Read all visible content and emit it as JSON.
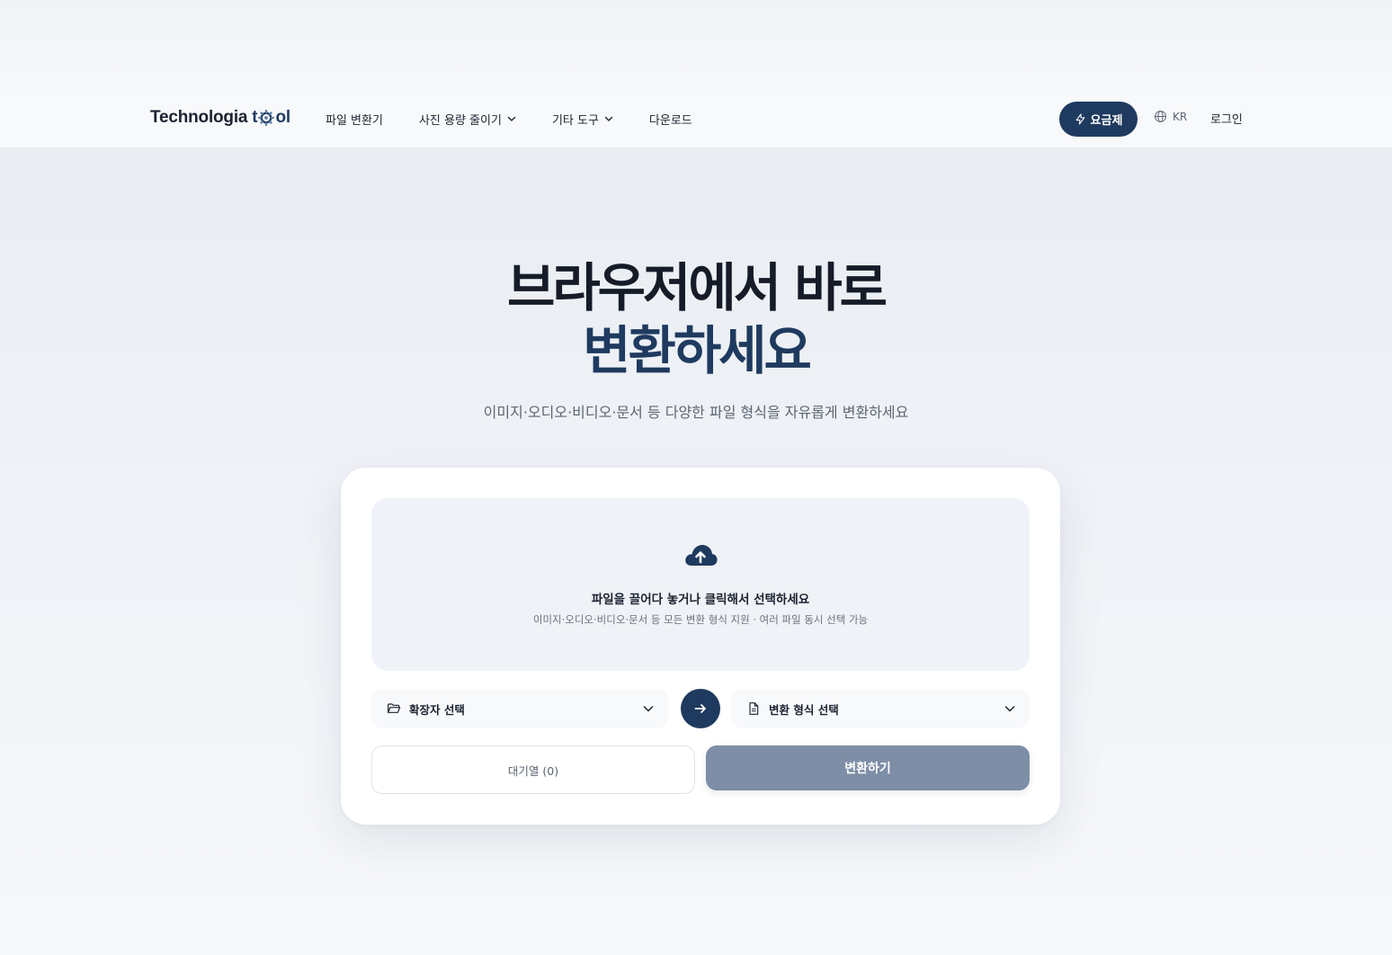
{
  "header": {
    "logo": {
      "text_part1": "Technologia",
      "text_part2_a": "t",
      "text_part2_b": "ol"
    },
    "nav": [
      {
        "label": "파일 변환기"
      },
      {
        "label": "사진 용량 줄이기"
      },
      {
        "label": "기타 도구"
      },
      {
        "label": "다운로드"
      }
    ],
    "pricing_label": "요금제",
    "lang_label": "KR",
    "login_label": "로그인"
  },
  "hero": {
    "title_line1": "브라우저에서 바로",
    "title_line2": "변환하세요",
    "subtitle": "이미지·오디오·비디오·문서 등 다양한 파일 형식을 자유롭게 변환하세요"
  },
  "converter": {
    "drop_title": "파일을 끌어다 놓거나 클릭해서 선택하세요",
    "drop_desc": "이미지·오디오·비디오·문서 등 모든 변환 형식 지원 · 여러 파일 동시 선택 가능",
    "source_select_label": "확장자 선택",
    "target_select_label": "변환 형식 선택",
    "queue_label": "대기열 (0)",
    "convert_label": "변환하기"
  },
  "colors": {
    "brand": "#1f3a5f",
    "convert_disabled": "#7d8ea6"
  },
  "icons": [
    "gear-icon",
    "chevron-down-icon",
    "lightning-icon",
    "globe-icon",
    "cloud-upload-icon",
    "folder-icon",
    "document-icon",
    "arrow-right-icon"
  ]
}
